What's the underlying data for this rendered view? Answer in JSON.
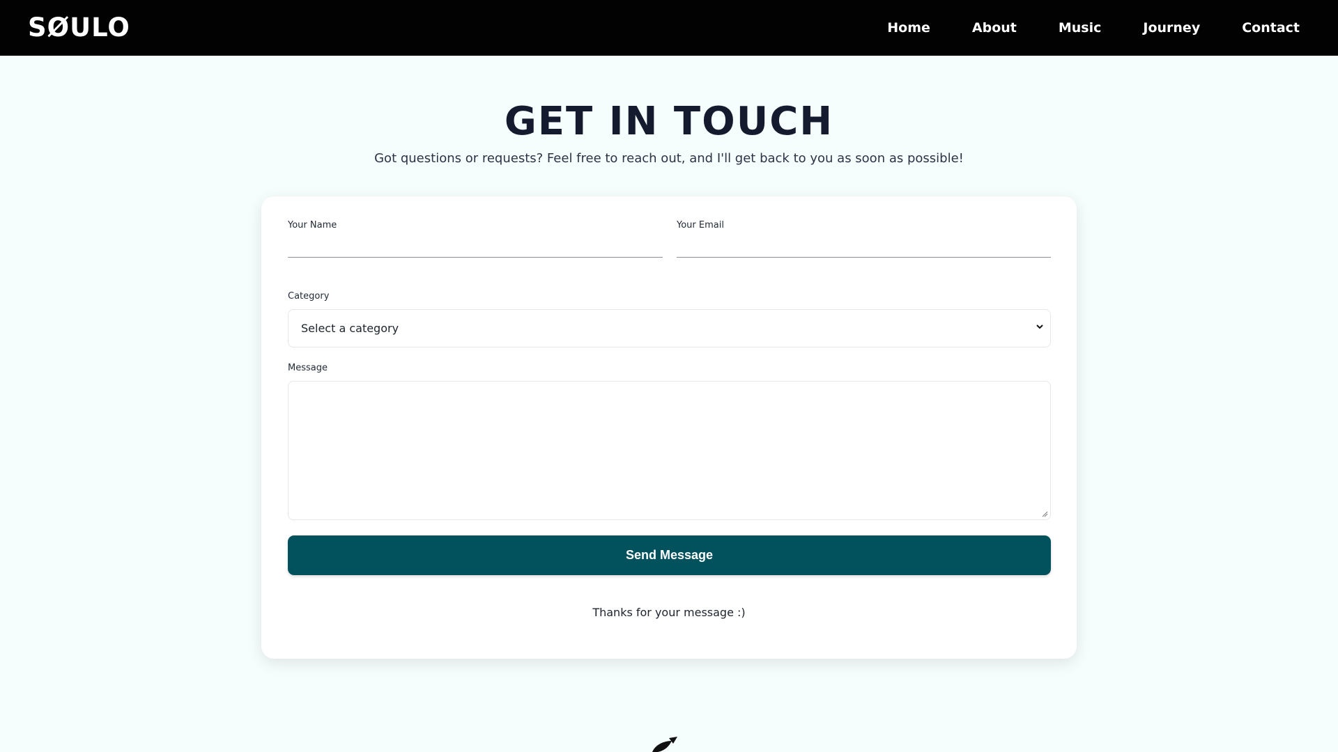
{
  "header": {
    "logo": "SØULO",
    "nav": [
      {
        "label": "Home"
      },
      {
        "label": "About"
      },
      {
        "label": "Music"
      },
      {
        "label": "Journey"
      },
      {
        "label": "Contact"
      }
    ]
  },
  "main": {
    "title": "GET IN TOUCH",
    "subtitle": "Got questions or requests? Feel free to reach out, and I'll get back to you as soon as possible!"
  },
  "form": {
    "name_label": "Your Name",
    "name_value": "",
    "email_label": "Your Email",
    "email_value": "",
    "category_label": "Category",
    "category_selected": "Select a category",
    "message_label": "Message",
    "message_value": "",
    "submit_label": "Send Message",
    "confirmation": "Thanks for your message :)"
  },
  "icons": {
    "select_arrow": "chevron-down-icon",
    "textarea_resize": "resize-grip-icon",
    "footer_logo": "leaf-logo-icon"
  },
  "colors": {
    "header_bg": "#020202",
    "page_bg": "#f5fdfd",
    "button_bg": "#02525d",
    "title_text": "#141b2e"
  }
}
